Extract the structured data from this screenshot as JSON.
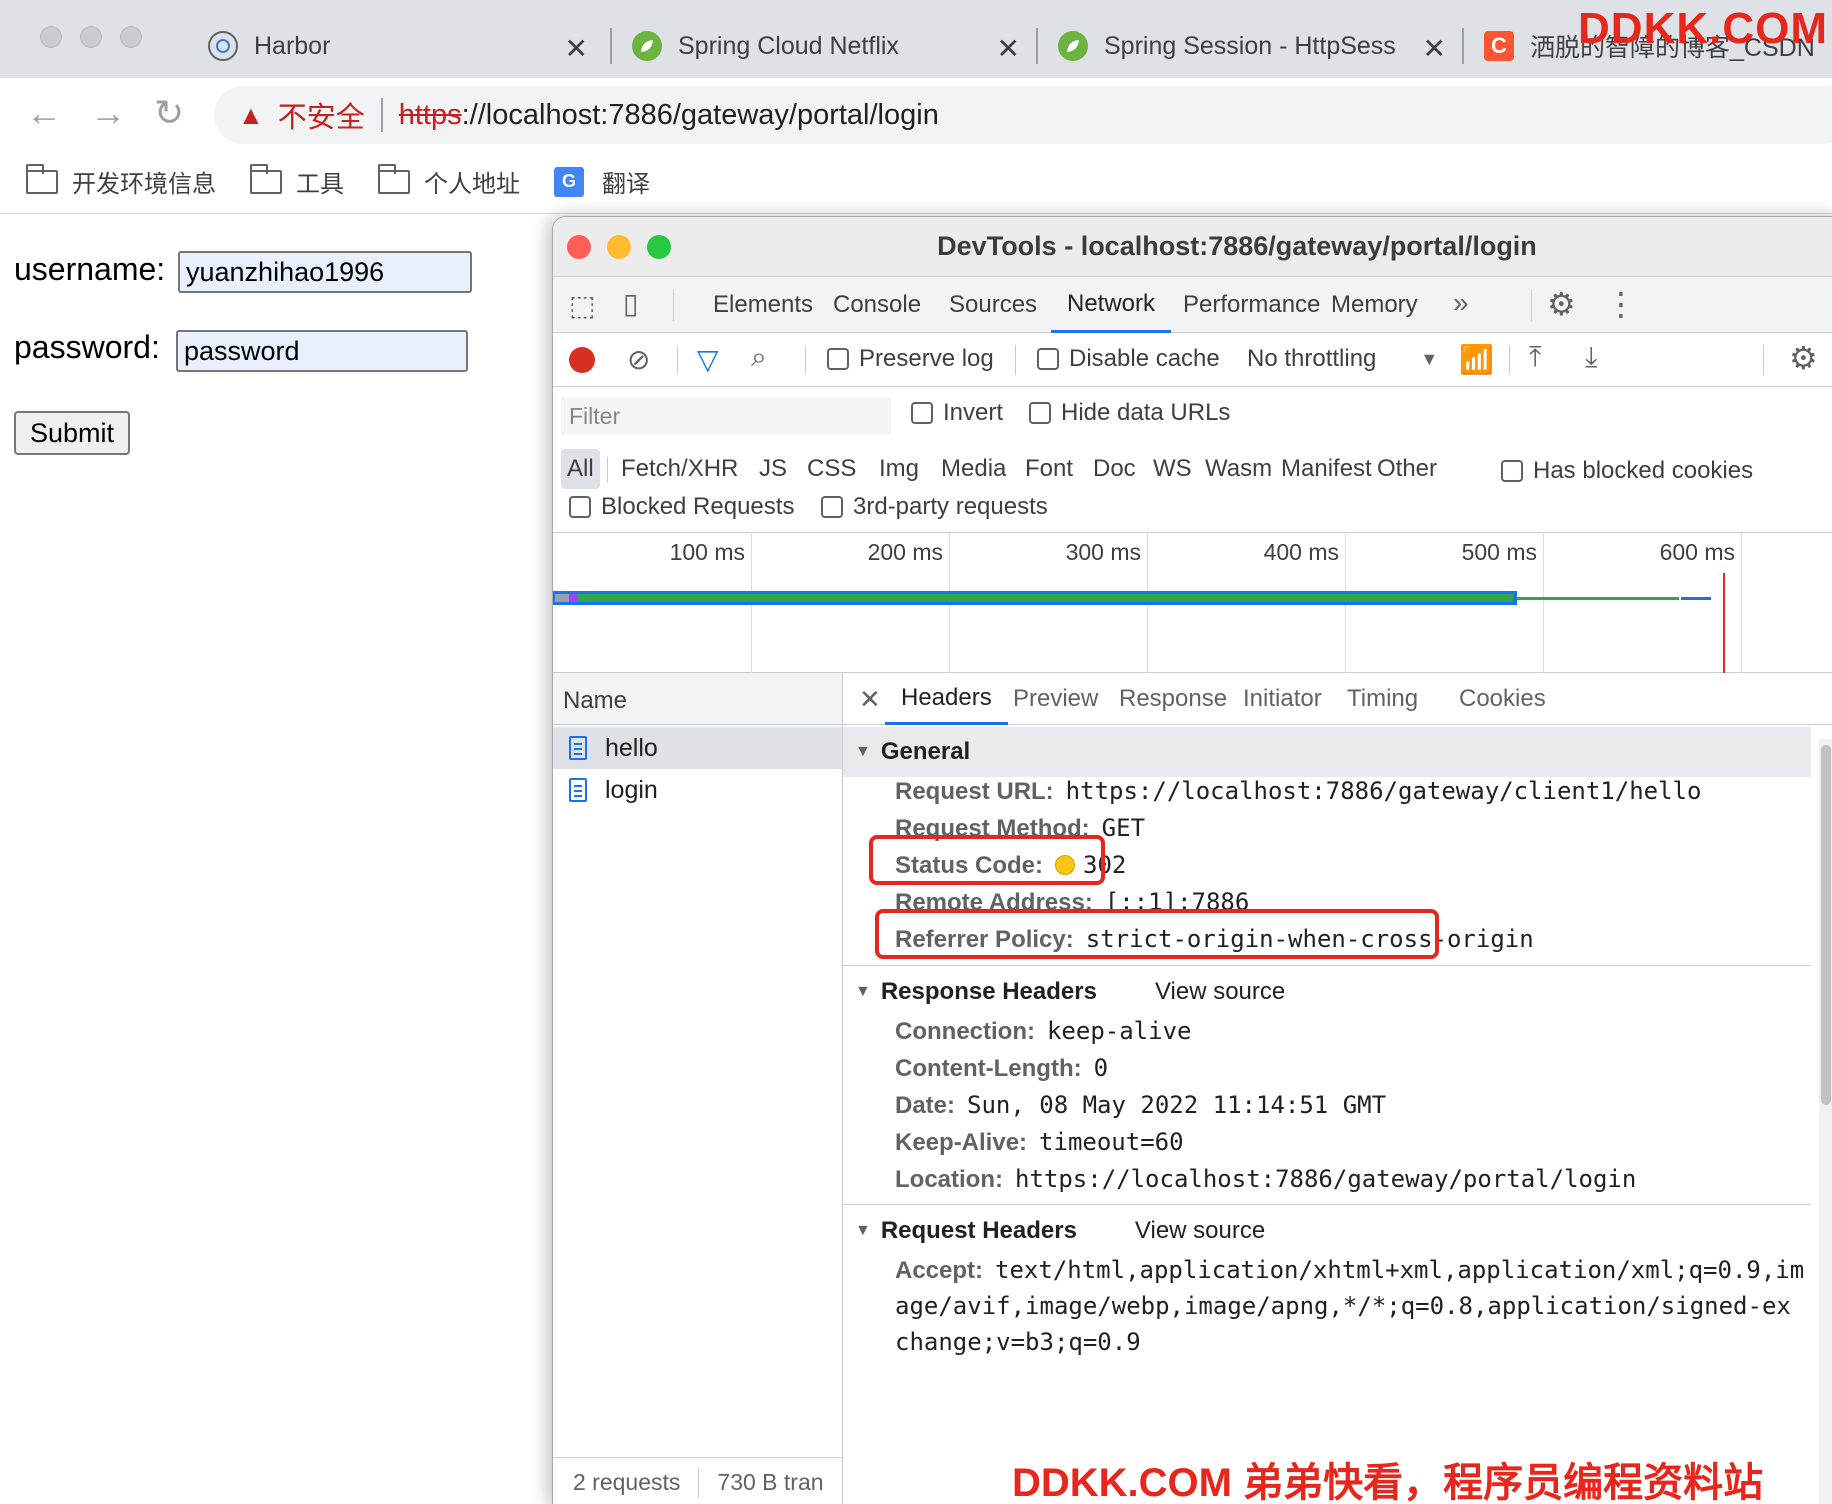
{
  "browser": {
    "tabs": [
      {
        "title": "Harbor"
      },
      {
        "title": "Spring Cloud Netflix"
      },
      {
        "title": "Spring Session - HttpSess"
      },
      {
        "title": "洒脱的智障的博客_CSDN"
      }
    ],
    "address": {
      "insecure_label": "不安全",
      "protocol": "https",
      "rest": "://localhost:7886/gateway/portal/login"
    },
    "bookmarks": [
      "开发环境信息",
      "工具",
      "个人地址",
      "翻译"
    ]
  },
  "watermarks": {
    "top": "DDKK.COM",
    "bottom": "DDKK.COM 弟弟快看，程序员编程资料站"
  },
  "page": {
    "username_label": "username:",
    "username_value": "yuanzhihao1996",
    "password_label": "password:",
    "password_value": "password",
    "submit_label": "Submit"
  },
  "devtools": {
    "title": "DevTools - localhost:7886/gateway/portal/login",
    "tabs": [
      "Elements",
      "Console",
      "Sources",
      "Network",
      "Performance",
      "Memory"
    ],
    "active_tab": "Network",
    "toolbar": {
      "preserve_log": "Preserve log",
      "disable_cache": "Disable cache",
      "throttling": "No throttling"
    },
    "filter": {
      "placeholder": "Filter",
      "invert": "Invert",
      "hide_data_urls": "Hide data URLs",
      "types": [
        "All",
        "Fetch/XHR",
        "JS",
        "CSS",
        "Img",
        "Media",
        "Font",
        "Doc",
        "WS",
        "Wasm",
        "Manifest",
        "Other"
      ],
      "has_blocked_cookies": "Has blocked cookies",
      "blocked_requests": "Blocked Requests",
      "third_party": "3rd-party requests"
    },
    "timeline_ticks": [
      "100 ms",
      "200 ms",
      "300 ms",
      "400 ms",
      "500 ms",
      "600 ms"
    ],
    "requests": {
      "header": "Name",
      "items": [
        "hello",
        "login"
      ],
      "status_count": "2 requests",
      "status_transfer": "730 B tran"
    },
    "detail_tabs": [
      "Headers",
      "Preview",
      "Response",
      "Initiator",
      "Timing",
      "Cookies"
    ],
    "general": {
      "title": "General",
      "request_url_k": "Request URL:",
      "request_url_v": "https://localhost:7886/gateway/client1/hello",
      "method_k": "Request Method:",
      "method_v": "GET",
      "status_k": "Status Code:",
      "status_v": "302",
      "remote_k": "Remote Address:",
      "remote_v": "[::1]:7886",
      "referrer_k": "Referrer Policy:",
      "referrer_v": "strict-origin-when-cross-origin"
    },
    "response_headers": {
      "title": "Response Headers",
      "view_source": "View source",
      "connection_k": "Connection:",
      "connection_v": "keep-alive",
      "length_k": "Content-Length:",
      "length_v": "0",
      "date_k": "Date:",
      "date_v": "Sun, 08 May 2022 11:14:51 GMT",
      "keepalive_k": "Keep-Alive:",
      "keepalive_v": "timeout=60",
      "location_k": "Location:",
      "location_v": "https://localhost:7886/gateway/portal/login"
    },
    "request_headers": {
      "title": "Request Headers",
      "view_source": "View source",
      "accept_k": "Accept:",
      "accept_line1": "text/html,application/xhtml+xml,application/xml;q=0.9,im",
      "accept_line2": "age/avif,image/webp,image/apng,*/*;q=0.8,application/signed-ex",
      "accept_line3": "change;v=b3;q=0.9"
    }
  },
  "colors": {
    "accent": "#1a73e8",
    "highlight": "#e8261c",
    "status_dot": "#f9c513"
  }
}
